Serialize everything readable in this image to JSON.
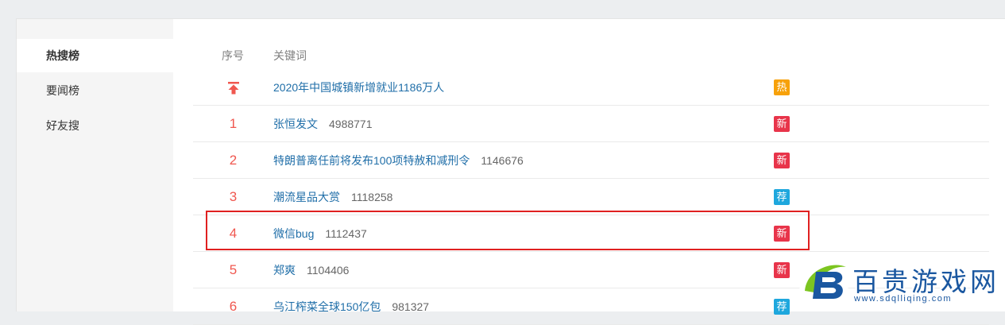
{
  "sidebar": {
    "items": [
      {
        "label": "热搜榜",
        "active": true
      },
      {
        "label": "要闻榜",
        "active": false
      },
      {
        "label": "好友搜",
        "active": false
      }
    ]
  },
  "table": {
    "headers": {
      "rank": "序号",
      "keyword": "关键词"
    },
    "rows": [
      {
        "rank": "",
        "rank_icon": "pin-top-icon",
        "keyword": "2020年中国城镇新增就业1186万人",
        "count": "",
        "badge": "热",
        "badge_color": "#f7a10a"
      },
      {
        "rank": "1",
        "keyword": "张恒发文",
        "count": "4988771",
        "badge": "新",
        "badge_color": "#e8344a"
      },
      {
        "rank": "2",
        "keyword": "特朗普离任前将发布100项特赦和减刑令",
        "count": "1146676",
        "badge": "新",
        "badge_color": "#e8344a"
      },
      {
        "rank": "3",
        "keyword": "潮流星品大赏",
        "count": "1118258",
        "badge": "荐",
        "badge_color": "#1ea7dd"
      },
      {
        "rank": "4",
        "keyword": "微信bug",
        "count": "1112437",
        "badge": "新",
        "badge_color": "#e8344a"
      },
      {
        "rank": "5",
        "keyword": "郑爽",
        "count": "1104406",
        "badge": "新",
        "badge_color": "#e8344a"
      },
      {
        "rank": "6",
        "keyword": "乌江榨菜全球150亿包",
        "count": "981327",
        "badge": "荐",
        "badge_color": "#1ea7dd"
      }
    ]
  },
  "watermark": {
    "name": "百贵游戏网",
    "url": "www.sdqlliqing.com",
    "color": "#1a57a0"
  },
  "colors": {
    "link": "#1f6ea8",
    "rank": "#f0574f",
    "highlight": "#e02020"
  }
}
